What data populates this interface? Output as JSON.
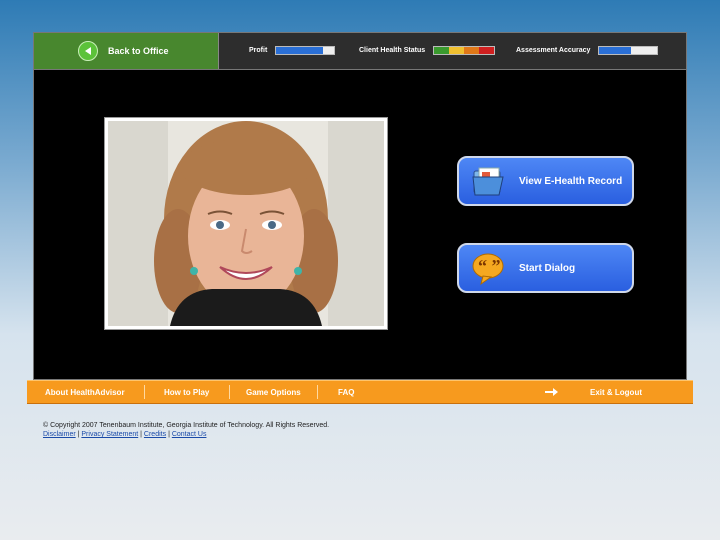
{
  "topbar": {
    "back_label": "Back to Office",
    "meters": [
      {
        "label": "Profit",
        "level": 0.8
      },
      {
        "label": "Client Health Status",
        "segments": [
          "#3a9a2e",
          "#f0c030",
          "#e07818",
          "#d02020"
        ]
      },
      {
        "label": "Assessment Accuracy",
        "level": 0.55
      }
    ]
  },
  "actions": {
    "record_label": "View E-Health Record",
    "dialog_label": "Start Dialog"
  },
  "nav": {
    "about": "About HealthAdvisor",
    "howto": "How to Play",
    "options": "Game Options",
    "faq": "FAQ",
    "exit": "Exit & Logout"
  },
  "footer": {
    "copyright": "© Copyright 2007 Tenenbaum Institute, Georgia Institute of Technology. All Rights Reserved.",
    "disclaimer": "Disclaimer",
    "privacy": "Privacy Statement",
    "credits": "Credits",
    "contact": "Contact Us"
  },
  "colors": {
    "accent": "#f79a1e",
    "button": "#2a5fe0",
    "back": "#48872e"
  }
}
